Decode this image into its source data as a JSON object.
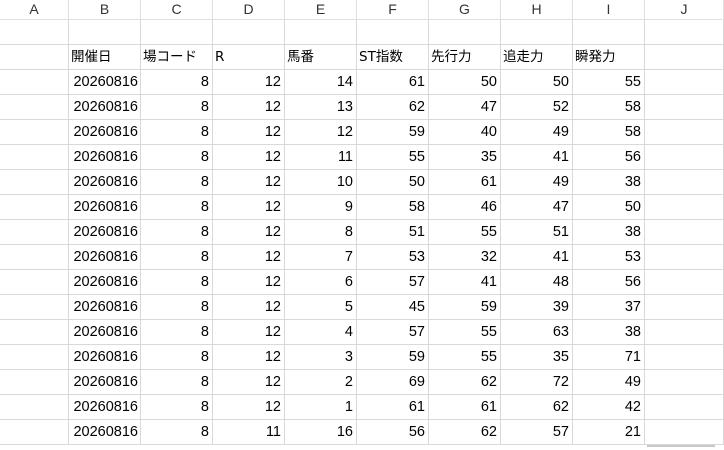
{
  "columns": [
    "A",
    "B",
    "C",
    "D",
    "E",
    "F",
    "G",
    "H",
    "I",
    "J"
  ],
  "header_row": [
    "開催日",
    "場コード",
    "R",
    "馬番",
    "ST指数",
    "先行力",
    "追走力",
    "瞬発力"
  ],
  "rows": [
    [
      "20260816",
      "8",
      "12",
      "14",
      "61",
      "50",
      "50",
      "55"
    ],
    [
      "20260816",
      "8",
      "12",
      "13",
      "62",
      "47",
      "52",
      "58"
    ],
    [
      "20260816",
      "8",
      "12",
      "12",
      "59",
      "40",
      "49",
      "58"
    ],
    [
      "20260816",
      "8",
      "12",
      "11",
      "55",
      "35",
      "41",
      "56"
    ],
    [
      "20260816",
      "8",
      "12",
      "10",
      "50",
      "61",
      "49",
      "38"
    ],
    [
      "20260816",
      "8",
      "12",
      "9",
      "58",
      "46",
      "47",
      "50"
    ],
    [
      "20260816",
      "8",
      "12",
      "8",
      "51",
      "55",
      "51",
      "38"
    ],
    [
      "20260816",
      "8",
      "12",
      "7",
      "53",
      "32",
      "41",
      "53"
    ],
    [
      "20260816",
      "8",
      "12",
      "6",
      "57",
      "41",
      "48",
      "56"
    ],
    [
      "20260816",
      "8",
      "12",
      "5",
      "45",
      "59",
      "39",
      "37"
    ],
    [
      "20260816",
      "8",
      "12",
      "4",
      "57",
      "55",
      "63",
      "38"
    ],
    [
      "20260816",
      "8",
      "12",
      "3",
      "59",
      "55",
      "35",
      "71"
    ],
    [
      "20260816",
      "8",
      "12",
      "2",
      "69",
      "62",
      "72",
      "49"
    ],
    [
      "20260816",
      "8",
      "12",
      "1",
      "61",
      "61",
      "62",
      "42"
    ],
    [
      "20260816",
      "8",
      "11",
      "16",
      "56",
      "62",
      "57",
      "21"
    ]
  ]
}
